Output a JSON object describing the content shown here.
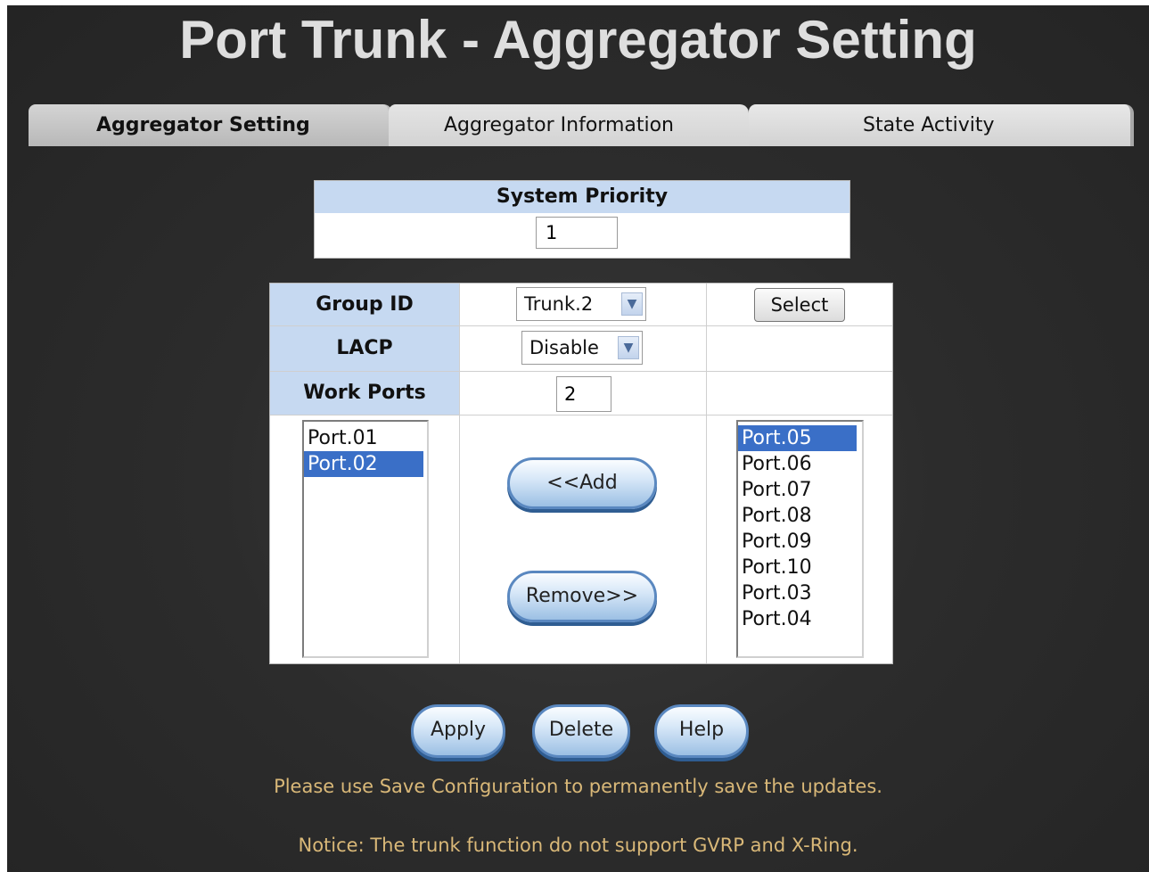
{
  "page": {
    "title": "Port Trunk - Aggregator Setting"
  },
  "tabs": [
    {
      "label": "Aggregator Setting",
      "active": true
    },
    {
      "label": "Aggregator Information",
      "active": false
    },
    {
      "label": "State Activity",
      "active": false
    }
  ],
  "system_priority": {
    "label": "System Priority",
    "value": "1"
  },
  "form": {
    "group_id_label": "Group ID",
    "group_id_value": "Trunk.2",
    "select_button": "Select",
    "lacp_label": "LACP",
    "lacp_value": "Disable",
    "work_ports_label": "Work Ports",
    "work_ports_value": "2"
  },
  "member_ports": [
    {
      "label": "Port.01",
      "selected": false
    },
    {
      "label": "Port.02",
      "selected": true
    }
  ],
  "available_ports": [
    {
      "label": "Port.05",
      "selected": true
    },
    {
      "label": "Port.06",
      "selected": false
    },
    {
      "label": "Port.07",
      "selected": false
    },
    {
      "label": "Port.08",
      "selected": false
    },
    {
      "label": "Port.09",
      "selected": false
    },
    {
      "label": "Port.10",
      "selected": false
    },
    {
      "label": "Port.03",
      "selected": false
    },
    {
      "label": "Port.04",
      "selected": false
    }
  ],
  "buttons": {
    "add": "<<Add",
    "remove": "Remove>>",
    "apply": "Apply",
    "delete": "Delete",
    "help": "Help"
  },
  "notices": {
    "save": "Please use Save Configuration to permanently save the updates.",
    "trunk": "Notice: The trunk function do not support GVRP and X-Ring."
  },
  "colors": {
    "background": "#2c2c2c",
    "header_cell": "#c6d9f1",
    "selection": "#3a6fc7",
    "notice_text": "#d9b878"
  },
  "icons": {
    "dropdown": "chevron-down-icon"
  }
}
